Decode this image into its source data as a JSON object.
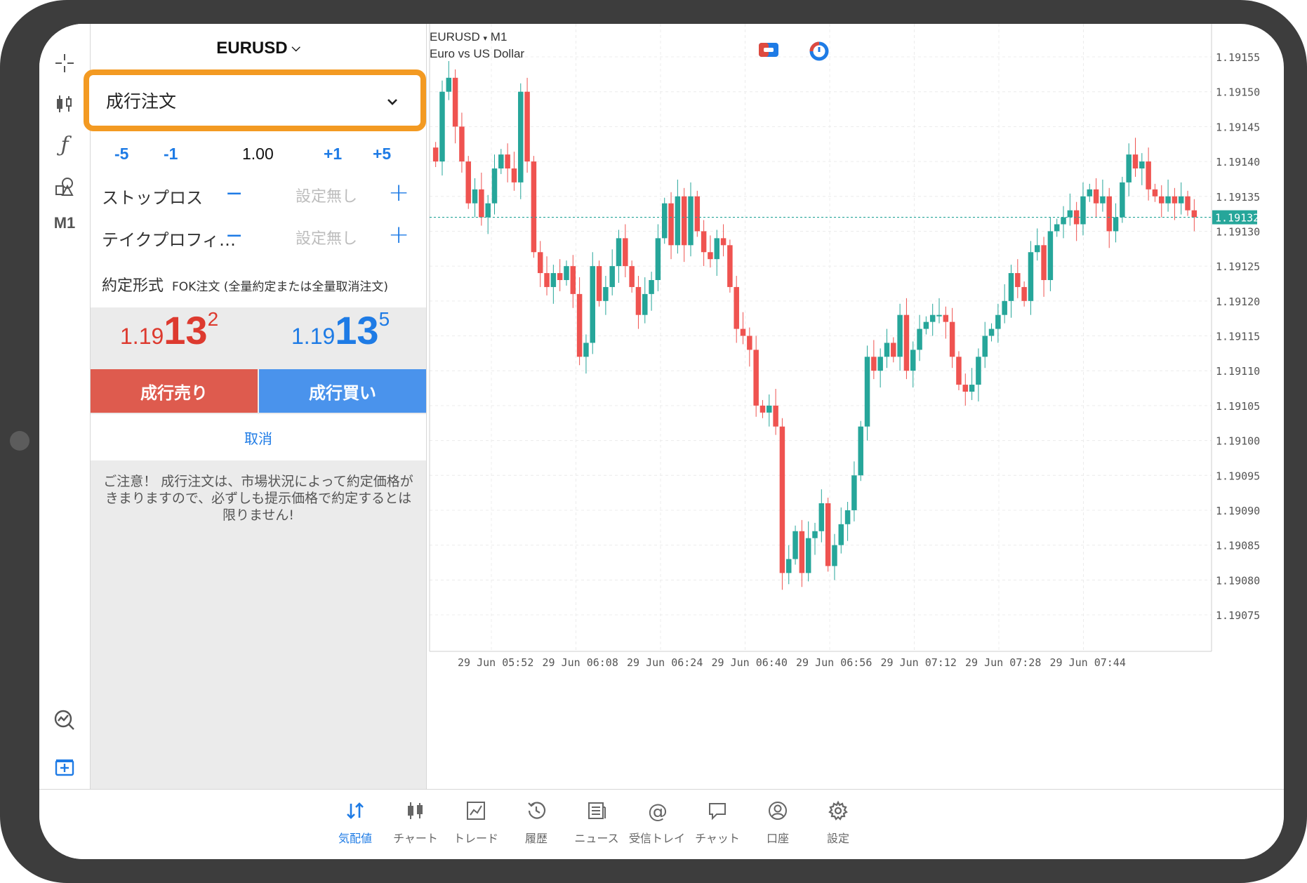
{
  "panel": {
    "symbol": "EURUSD",
    "order_type": "成行注文",
    "volume": {
      "m5": "-5",
      "m1": "-1",
      "value": "1.00",
      "p1": "+1",
      "p5": "+5"
    },
    "stop_loss": {
      "label": "ストップロス",
      "minus": "−",
      "value": "設定無し",
      "plus": "+"
    },
    "take_profit": {
      "label": "テイクプロフィ…",
      "minus": "−",
      "value": "設定無し",
      "plus": "+"
    },
    "fill": {
      "label": "約定形式",
      "value": "FOK注文 (全量約定または全量取消注文)"
    },
    "bid": {
      "prefix": "1.19",
      "big": "13",
      "sup": "2"
    },
    "ask": {
      "prefix": "1.19",
      "big": "13",
      "sup": "5"
    },
    "sell_label": "成行売り",
    "buy_label": "成行買い",
    "cancel_label": "取消",
    "notice": "ご注意！ 成行注文は、市場状況によって約定価格がきまりますので、必ずしも提示価格で約定するとは限りません!"
  },
  "toolbar": {
    "timeframe": "M1",
    "icons": [
      "crosshair-icon",
      "candles-icon",
      "function-icon",
      "objects-icon",
      "timeframe",
      "indicator-chart-icon",
      "add-window-icon"
    ]
  },
  "chart": {
    "symbol": "EURUSD",
    "timeframe": "M1",
    "description": "Euro vs US Dollar",
    "current_price": "1.19132",
    "colors": {
      "up": "#26a69a",
      "down": "#ef5350",
      "line": "#26a69a"
    }
  },
  "chart_data": {
    "type": "candlestick",
    "title": "EURUSD ▾ M1",
    "subtitle": "Euro vs US Dollar",
    "ylim": [
      1.19072,
      1.19157
    ],
    "yticks": [
      "1.19155",
      "1.19150",
      "1.19145",
      "1.19140",
      "1.19135",
      "1.19130",
      "1.19125",
      "1.19120",
      "1.19115",
      "1.19110",
      "1.19105",
      "1.19100",
      "1.19095",
      "1.19090",
      "1.19085",
      "1.19080",
      "1.19075"
    ],
    "xticks": [
      "29 Jun 05:52",
      "29 Jun 06:08",
      "29 Jun 06:24",
      "29 Jun 06:40",
      "29 Jun 06:56",
      "29 Jun 07:12",
      "29 Jun 07:28",
      "29 Jun 07:44"
    ],
    "last_price": 1.19132,
    "closes": [
      1.1914,
      1.1915,
      1.19152,
      1.19145,
      1.1914,
      1.19134,
      1.19136,
      1.19132,
      1.19134,
      1.19139,
      1.19141,
      1.19139,
      1.19137,
      1.1915,
      1.1914,
      1.19127,
      1.19124,
      1.19122,
      1.19124,
      1.19123,
      1.19125,
      1.19121,
      1.19112,
      1.19114,
      1.19125,
      1.1912,
      1.19122,
      1.19125,
      1.19129,
      1.19125,
      1.19122,
      1.19118,
      1.19121,
      1.19123,
      1.19129,
      1.19134,
      1.19128,
      1.19135,
      1.19128,
      1.19135,
      1.1913,
      1.19127,
      1.19126,
      1.19129,
      1.19128,
      1.19122,
      1.19116,
      1.19115,
      1.19113,
      1.19105,
      1.19104,
      1.19105,
      1.19102,
      1.19081,
      1.19083,
      1.19087,
      1.19081,
      1.19086,
      1.19087,
      1.19091,
      1.19082,
      1.19085,
      1.19088,
      1.1909,
      1.19095,
      1.19102,
      1.19112,
      1.1911,
      1.19112,
      1.19114,
      1.19112,
      1.19118,
      1.1911,
      1.19113,
      1.19116,
      1.19117,
      1.19118,
      1.19118,
      1.19117,
      1.19112,
      1.19108,
      1.19107,
      1.19108,
      1.19112,
      1.19115,
      1.19116,
      1.19118,
      1.1912,
      1.19124,
      1.19122,
      1.1912,
      1.19127,
      1.19128,
      1.19123,
      1.1913,
      1.19131,
      1.19132,
      1.19133,
      1.19131,
      1.19135,
      1.19136,
      1.19134,
      1.19135,
      1.1913,
      1.19132,
      1.19137,
      1.19141,
      1.19139,
      1.1914,
      1.19136,
      1.19135,
      1.19134,
      1.19135,
      1.19134,
      1.19135,
      1.19133,
      1.19132
    ]
  },
  "nav": [
    {
      "icon": "quotes-icon",
      "label": "気配値",
      "active": true
    },
    {
      "icon": "chart-bars-icon",
      "label": "チャート",
      "active": false
    },
    {
      "icon": "trade-icon",
      "label": "トレード",
      "active": false
    },
    {
      "icon": "history-icon",
      "label": "履歴",
      "active": false
    },
    {
      "icon": "news-icon",
      "label": "ニュース",
      "active": false
    },
    {
      "icon": "mail-icon",
      "label": "受信トレイ",
      "active": false
    },
    {
      "icon": "chat-icon",
      "label": "チャット",
      "active": false
    },
    {
      "icon": "account-icon",
      "label": "口座",
      "active": false
    },
    {
      "icon": "settings-icon",
      "label": "設定",
      "active": false
    }
  ]
}
